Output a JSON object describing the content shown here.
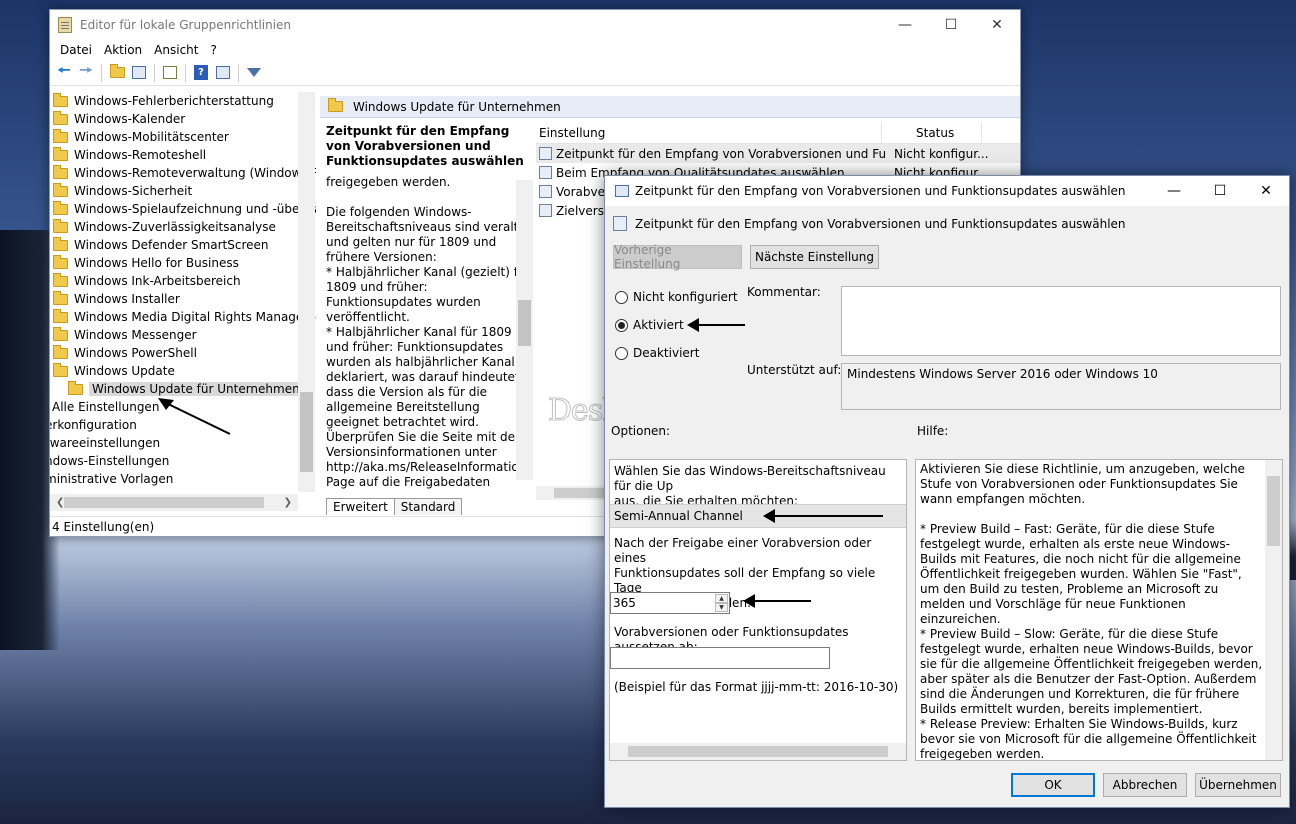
{
  "colors": {
    "accent": "#0078d7",
    "selection": "#d9d9d9",
    "folder": "#f1c94a"
  },
  "main_window": {
    "title": "Editor für lokale Gruppenrichtlinien",
    "menu": [
      "Datei",
      "Aktion",
      "Ansicht",
      "?"
    ],
    "toolbar_icons": [
      "back-arrow-icon",
      "forward-arrow-icon",
      "up-folder-icon",
      "show-hide-tree-icon",
      "export-list-icon",
      "help-icon",
      "properties-icon",
      "filter-icon"
    ],
    "tree_items": [
      {
        "label": "Windows-Fehlerberichterstattung",
        "indent": 1,
        "folder": true
      },
      {
        "label": "Windows-Kalender",
        "indent": 1,
        "folder": true
      },
      {
        "label": "Windows-Mobilitätscenter",
        "indent": 1,
        "folder": true
      },
      {
        "label": "Windows-Remoteshell",
        "indent": 1,
        "folder": true
      },
      {
        "label": "Windows-Remoteverwaltung (Windows Re",
        "indent": 1,
        "folder": true
      },
      {
        "label": "Windows-Sicherheit",
        "indent": 1,
        "folder": true
      },
      {
        "label": "Windows-Spielaufzeichnung und -übertrag",
        "indent": 1,
        "folder": true
      },
      {
        "label": "Windows-Zuverlässigkeitsanalyse",
        "indent": 1,
        "folder": true
      },
      {
        "label": "Windows Defender SmartScreen",
        "indent": 1,
        "folder": true
      },
      {
        "label": "Windows Hello for Business",
        "indent": 1,
        "folder": true
      },
      {
        "label": "Windows Ink-Arbeitsbereich",
        "indent": 1,
        "folder": true
      },
      {
        "label": "Windows Installer",
        "indent": 1,
        "folder": true
      },
      {
        "label": "Windows Media Digital Rights Managemer",
        "indent": 1,
        "folder": true
      },
      {
        "label": "Windows Messenger",
        "indent": 1,
        "folder": true
      },
      {
        "label": "Windows PowerShell",
        "indent": 1,
        "folder": true
      },
      {
        "label": "Windows Update",
        "indent": 1,
        "folder": true
      },
      {
        "label": "Windows Update für Unternehmen",
        "indent": 2,
        "folder": true,
        "selected": true
      },
      {
        "label": "Alle Einstellungen",
        "indent": 0,
        "folder": false
      },
      {
        "label": "erkonfiguration",
        "indent": -1,
        "folder": false
      },
      {
        "label": "twareeinstellungen",
        "indent": -1,
        "folder": false
      },
      {
        "label": "ndows-Einstellungen",
        "indent": -1,
        "folder": false
      },
      {
        "label": "ministrative Vorlagen",
        "indent": -1,
        "folder": false
      }
    ],
    "content_header": "Windows Update für Unternehmen",
    "description": {
      "title": "Zeitpunkt für den Empfang von Vorabversionen und Funktionsupdates auswählen",
      "text": "freigegeben werden.\n\nDie folgenden Windows-Bereitschaftsniveaus sind veraltet und gelten nur für 1809 und frühere Versionen:\n* Halbjährlicher Kanal (gezielt) für 1809 und früher: Funktionsupdates wurden veröffentlicht.\n* Halbjährlicher Kanal für 1809 und früher: Funktionsupdates wurden als halbjährlicher Kanal deklariert, was darauf hindeutet, dass die Version als für die allgemeine Bereitstellung geeignet betrachtet wird.\nÜberprüfen Sie die Seite mit den Versionsinformationen unter http://aka.ms/ReleaseInformation\nPage auf die Freigabedaten"
    },
    "list": {
      "col_setting": "Einstellung",
      "col_status": "Status",
      "rows": [
        {
          "name": "Zeitpunkt für den Empfang von Vorabversionen und Funktio...",
          "status": "Nicht konfigur..."
        },
        {
          "name": "Beim Empfang von Qualitätsupdates auswählen",
          "status": "Nicht konfigur..."
        },
        {
          "name": "Vorabvers",
          "status": ""
        },
        {
          "name": "Zielversio",
          "status": ""
        }
      ]
    },
    "tabs": [
      "Erweitert",
      "Standard"
    ],
    "status": "4 Einstellung(en)"
  },
  "dialog": {
    "title": "Zeitpunkt für den Empfang von Vorabversionen und Funktionsupdates auswählen",
    "subtitle": "Zeitpunkt für den Empfang von Vorabversionen und Funktionsupdates auswählen",
    "prev_button": "Vorherige Einstellung",
    "next_button": "Nächste Einstellung",
    "radio_not_configured": "Nicht konfiguriert",
    "radio_enabled": "Aktiviert",
    "radio_disabled": "Deaktiviert",
    "selected_state": "Aktiviert",
    "comment_label": "Kommentar:",
    "comment_value": "",
    "supported_label": "Unterstützt auf:",
    "supported_value": "Mindestens Windows Server 2016 oder Windows 10",
    "options_label": "Optionen:",
    "help_label": "Hilfe:",
    "options": {
      "readiness_prompt": "Wählen Sie das Windows-Bereitschaftsniveau für die Up\naus, die Sie erhalten möchten:",
      "readiness_value": "Semi-Annual Channel",
      "defer_prompt": "Nach der Freigabe einer Vorabversion oder eines\nFunktionsupdates soll der Empfang so viele Tage\nzurückgestellt werden:",
      "defer_days": "365",
      "pause_prompt": "Vorabversionen oder Funktionsupdates aussetzen ab:",
      "pause_value": "",
      "format_hint": "(Beispiel für das Format jjjj-mm-tt: 2016-10-30)"
    },
    "help_text": "Aktivieren Sie diese Richtlinie, um anzugeben, welche Stufe von Vorabversionen oder Funktionsupdates Sie wann empfangen möchten.\n\n* Preview Build – Fast: Geräte, für die diese Stufe festgelegt wurde, erhalten als erste neue Windows-Builds mit Features, die noch nicht für die allgemeine Öffentlichkeit freigegeben wurden. Wählen Sie \"Fast\", um den Build zu testen, Probleme an Microsoft zu melden und Vorschläge für neue Funktionen einzureichen.\n* Preview Build – Slow: Geräte, für die diese Stufe festgelegt wurde, erhalten neue Windows-Builds, bevor sie für die allgemeine Öffentlichkeit freigegeben werden, aber später als die Benutzer der Fast-Option. Außerdem sind die Änderungen und Korrekturen, die für frühere Builds ermittelt wurden, bereits implementiert.\n*  Release Preview: Erhalten Sie Windows-Builds, kurz bevor sie von Microsoft für die allgemeine Öffentlichkeit freigegeben werden.\n* Halbjährlicher Kanal: Erhalten Sie Funktionsupdates sofort",
    "ok": "OK",
    "cancel": "Abbrechen",
    "apply": "Übernehmen"
  },
  "watermark": "Deskmodder.de"
}
